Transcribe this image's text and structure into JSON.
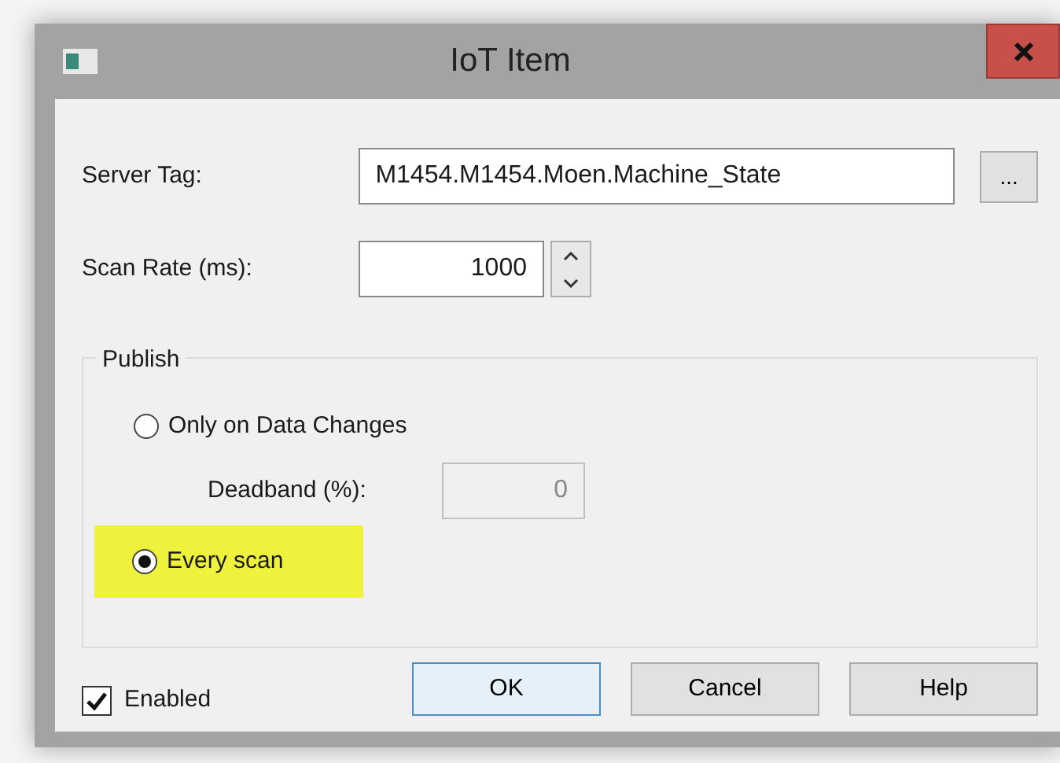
{
  "window": {
    "title": "IoT Item"
  },
  "server_tag": {
    "label": "Server Tag:",
    "value": "M1454.M1454.Moen.Machine_State",
    "browse_button": "..."
  },
  "scan_rate": {
    "label": "Scan Rate (ms):",
    "value": "1000"
  },
  "publish": {
    "title": "Publish",
    "options": [
      {
        "label": "Only on Data Changes",
        "selected": false,
        "highlighted": false
      },
      {
        "label": "Every scan",
        "selected": true,
        "highlighted": true
      }
    ],
    "deadband": {
      "label": "Deadband (%):",
      "value": "0",
      "disabled": true
    }
  },
  "enabled": {
    "label": "Enabled",
    "checked": true
  },
  "buttons": [
    {
      "label": "OK",
      "default": true
    },
    {
      "label": "Cancel",
      "default": false
    },
    {
      "label": "Help",
      "default": false
    }
  ]
}
